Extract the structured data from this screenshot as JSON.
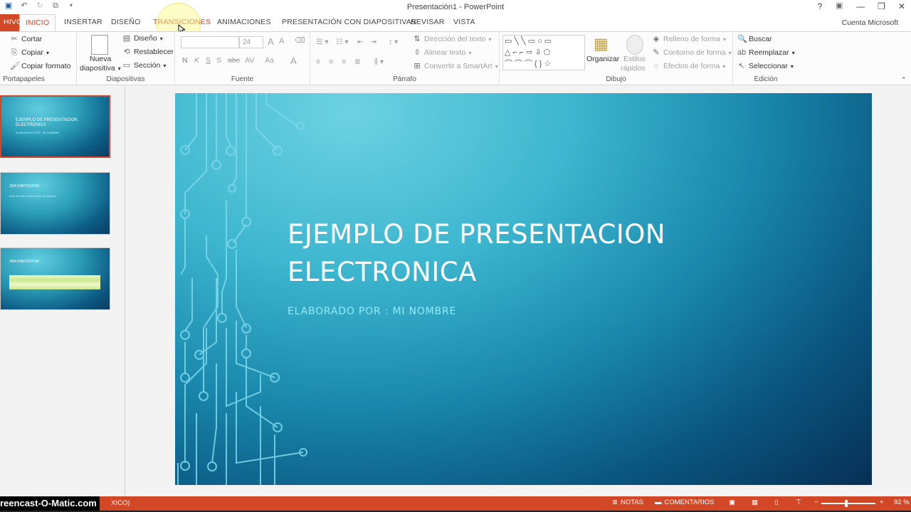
{
  "window": {
    "title": "Presentación1 - PowerPoint",
    "account": "Cuenta Microsoft",
    "help": "?"
  },
  "tabs": [
    {
      "label": "HIVO"
    },
    {
      "label": "INICIO"
    },
    {
      "label": "INSERTAR"
    },
    {
      "label": "DISEÑO"
    },
    {
      "label": "TRANSICIONES"
    },
    {
      "label": "ANIMACIONES"
    },
    {
      "label": "PRESENTACIÓN CON DIAPOSITIVAS"
    },
    {
      "label": "REVISAR"
    },
    {
      "label": "VISTA"
    }
  ],
  "ribbon": {
    "portapapeles": {
      "label": "Portapapeles",
      "cut": "Cortar",
      "copy": "Copiar",
      "format": "Copiar formato"
    },
    "diapositivas": {
      "label": "Diapositivas",
      "new1": "Nueva",
      "new2": "diapositiva",
      "design": "Diseño",
      "reset": "Restablecer",
      "section": "Sección"
    },
    "fuente": {
      "label": "Fuente",
      "size": "24",
      "bold": "N",
      "italic": "K",
      "underline": "S",
      "strike": "abc",
      "spacing": "AV",
      "case": "Aa",
      "grow": "A",
      "shrink": "A",
      "color": "A"
    },
    "parrafo": {
      "label": "Párrafo",
      "direction": "Dirección del texto",
      "align": "Alinear texto",
      "smartart": "Convertir a SmartArt"
    },
    "dibujo": {
      "label": "Dibujo",
      "arrange": "Organizar",
      "styles1": "Estilos",
      "styles2": "rápidos",
      "fill": "Relleno de forma",
      "outline": "Contorno de forma",
      "effects": "Efectos de forma"
    },
    "edicion": {
      "label": "Edición",
      "find": "Buscar",
      "replace": "Reemplazar",
      "select": "Seleccionar"
    }
  },
  "thumbnails": [
    {
      "title": "EJEMPLO DE PRESENTACION ELECTRONICA",
      "subtitle": "ELABORADO POR : MI NOMBRE"
    },
    {
      "title": "2DA DIAPOSITIVA",
      "subtitle": "Esta es una presentación de ejemplo"
    },
    {
      "title": "3RA DIAPOSITIVA",
      "subtitle": ""
    }
  ],
  "slide": {
    "title_line1": "EJEMPLO DE PRESENTACION",
    "title_line2": "ELECTRONICA",
    "subtitle": "ELABORADO POR : MI NOMBRE"
  },
  "statusbar": {
    "language": "XICO)",
    "notes": "NOTAS",
    "comments": "COMENTARIOS",
    "zoom": "92 %",
    "watermark": "reencast-O-Matic.com"
  },
  "colors": {
    "accent": "#d24726",
    "slide_dark": "#072f55",
    "slide_light": "#6dd2e2"
  }
}
